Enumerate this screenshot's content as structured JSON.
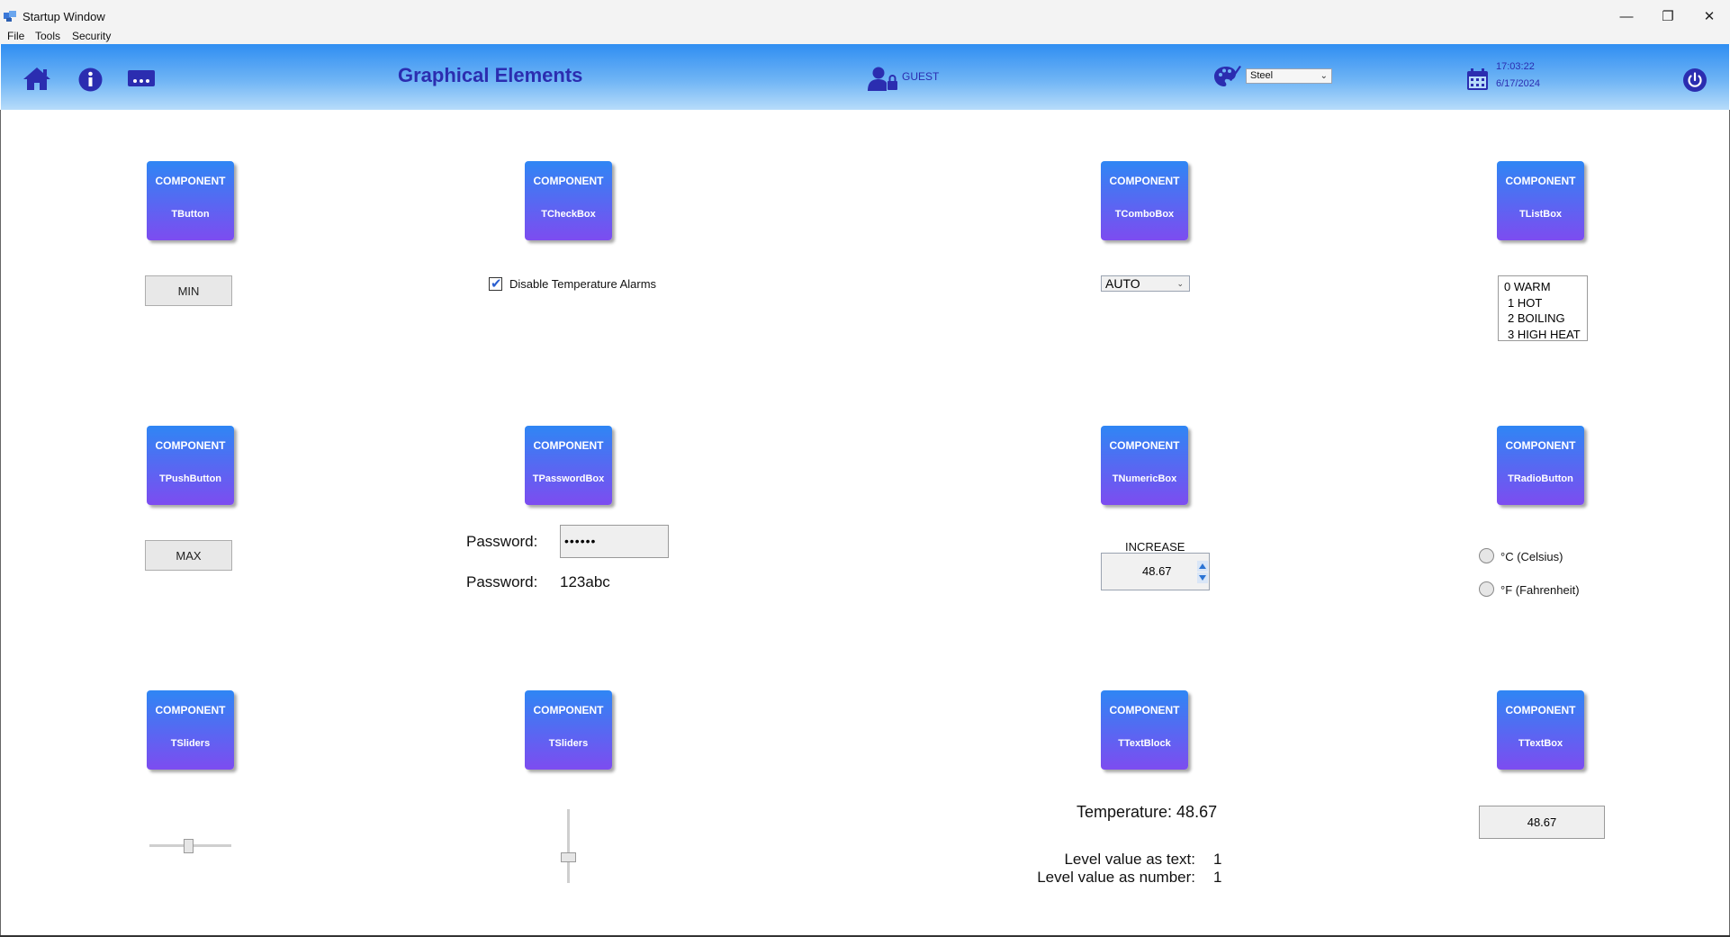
{
  "window": {
    "title": "Startup Window",
    "controls": {
      "minimize": "—",
      "restore": "❐",
      "close": "✕"
    }
  },
  "menu": [
    "File",
    "Tools",
    "Security"
  ],
  "header": {
    "title": "Graphical Elements",
    "user": "GUEST",
    "theme": "Steel",
    "time": "17:03:22",
    "date": "6/17/2024",
    "icons": [
      "home-icon",
      "info-icon",
      "more-icon",
      "user-lock-icon",
      "palette-icon",
      "calendar-icon",
      "power-icon"
    ],
    "accent_color": "#2b2db0"
  },
  "tiles": [
    {
      "top": "COMPONENT",
      "name": "TButton"
    },
    {
      "top": "COMPONENT",
      "name": "TCheckBox"
    },
    {
      "top": "COMPONENT",
      "name": "TComboBox"
    },
    {
      "top": "COMPONENT",
      "name": "TListBox"
    },
    {
      "top": "COMPONENT",
      "name": "TPushButton"
    },
    {
      "top": "COMPONENT",
      "name": "TPasswordBox"
    },
    {
      "top": "COMPONENT",
      "name": "TNumericBox"
    },
    {
      "top": "COMPONENT",
      "name": "TRadioButton"
    },
    {
      "top": "COMPONENT",
      "name": "TSliders"
    },
    {
      "top": "COMPONENT",
      "name": "TSliders"
    },
    {
      "top": "COMPONENT",
      "name": "TTextBlock"
    },
    {
      "top": "COMPONENT",
      "name": "TTextBox"
    }
  ],
  "controls": {
    "min_button": "MIN",
    "max_button": "MAX",
    "checkbox": {
      "label": "Disable Temperature Alarms",
      "checked": true,
      "check_glyph": "✔"
    },
    "combo": {
      "value": "AUTO",
      "chevron": "⌄"
    },
    "listbox": [
      "0 WARM",
      "1 HOT",
      "2 BOILING",
      "3 HIGH HEAT"
    ],
    "password": {
      "label": "Password:",
      "masked": "••••••",
      "plain": "123abc"
    },
    "numeric": {
      "label": "INCREASE",
      "value": "48.67"
    },
    "radios": [
      "°C (Celsius)",
      "°F (Fahrenheit)"
    ],
    "textblock": {
      "temperature": "Temperature: 48.67",
      "level_text_label": "Level value as text:",
      "level_text_value": "1",
      "level_number_label": "Level value as number:",
      "level_number_value": "1"
    },
    "textbox_value": "48.67"
  }
}
